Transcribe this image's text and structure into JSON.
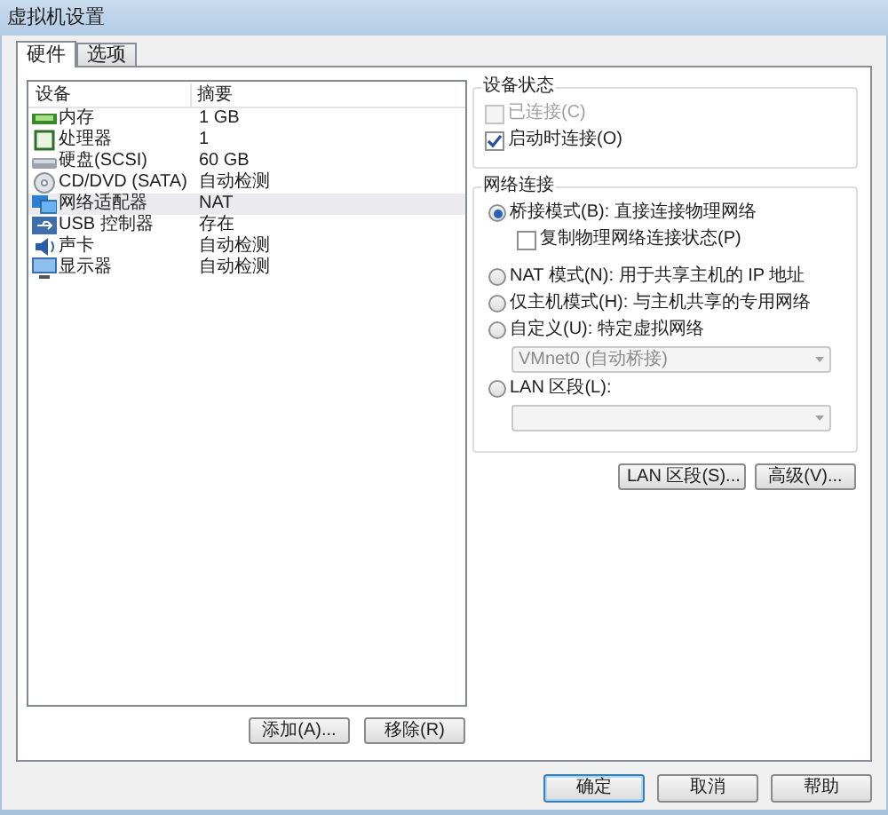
{
  "window": {
    "title": "虚拟机设置"
  },
  "tabs": [
    {
      "label": "硬件",
      "selected": true
    },
    {
      "label": "选项",
      "selected": false
    }
  ],
  "devices": {
    "columns": [
      "设备",
      "摘要"
    ],
    "rows": [
      {
        "kind": "memory",
        "name": "内存",
        "summary": "1 GB",
        "selected": false
      },
      {
        "kind": "cpu",
        "name": "处理器",
        "summary": "1",
        "selected": false
      },
      {
        "kind": "disk",
        "name": "硬盘(SCSI)",
        "summary": "60 GB",
        "selected": false
      },
      {
        "kind": "cdrom",
        "name": "CD/DVD (SATA)",
        "summary": "自动检测",
        "selected": false
      },
      {
        "kind": "network",
        "name": "网络适配器",
        "summary": "NAT",
        "selected": true
      },
      {
        "kind": "usb",
        "name": "USB 控制器",
        "summary": "存在",
        "selected": false
      },
      {
        "kind": "sound",
        "name": "声卡",
        "summary": "自动检测",
        "selected": false
      },
      {
        "kind": "display",
        "name": "显示器",
        "summary": "自动检测",
        "selected": false
      }
    ]
  },
  "list_buttons": [
    "添加(A)...",
    "移除(R)"
  ],
  "device_status": {
    "title": "设备状态",
    "items": [
      {
        "label": "已连接(C)",
        "checked": false,
        "disabled": true
      },
      {
        "label": "启动时连接(O)",
        "checked": true,
        "disabled": false
      }
    ]
  },
  "network_connection": {
    "title": "网络连接",
    "items": [
      {
        "kind": "radio",
        "label": "桥接模式(B): 直接连接物理网络",
        "selected": true
      },
      {
        "kind": "checkbox",
        "label": "复制物理网络连接状态(P)",
        "checked": false
      },
      {
        "kind": "radio",
        "label": "NAT 模式(N): 用于共享主机的 IP 地址",
        "selected": false
      },
      {
        "kind": "radio",
        "label": "仅主机模式(H): 与主机共享的专用网络",
        "selected": false
      },
      {
        "kind": "radio",
        "label": "自定义(U): 特定虚拟网络",
        "selected": false
      },
      {
        "kind": "select",
        "value": "VMnet0 (自动桥接)",
        "disabled": true
      },
      {
        "kind": "radio",
        "label": "LAN 区段(L):",
        "selected": false
      },
      {
        "kind": "select",
        "disabled": true
      }
    ]
  },
  "network_buttons": [
    "LAN 区段(S)...",
    "高级(V)..."
  ],
  "dialog_buttons": [
    {
      "label": "确定",
      "default": true
    },
    {
      "label": "取消",
      "default": false
    },
    {
      "label": "帮助",
      "default": false
    }
  ]
}
